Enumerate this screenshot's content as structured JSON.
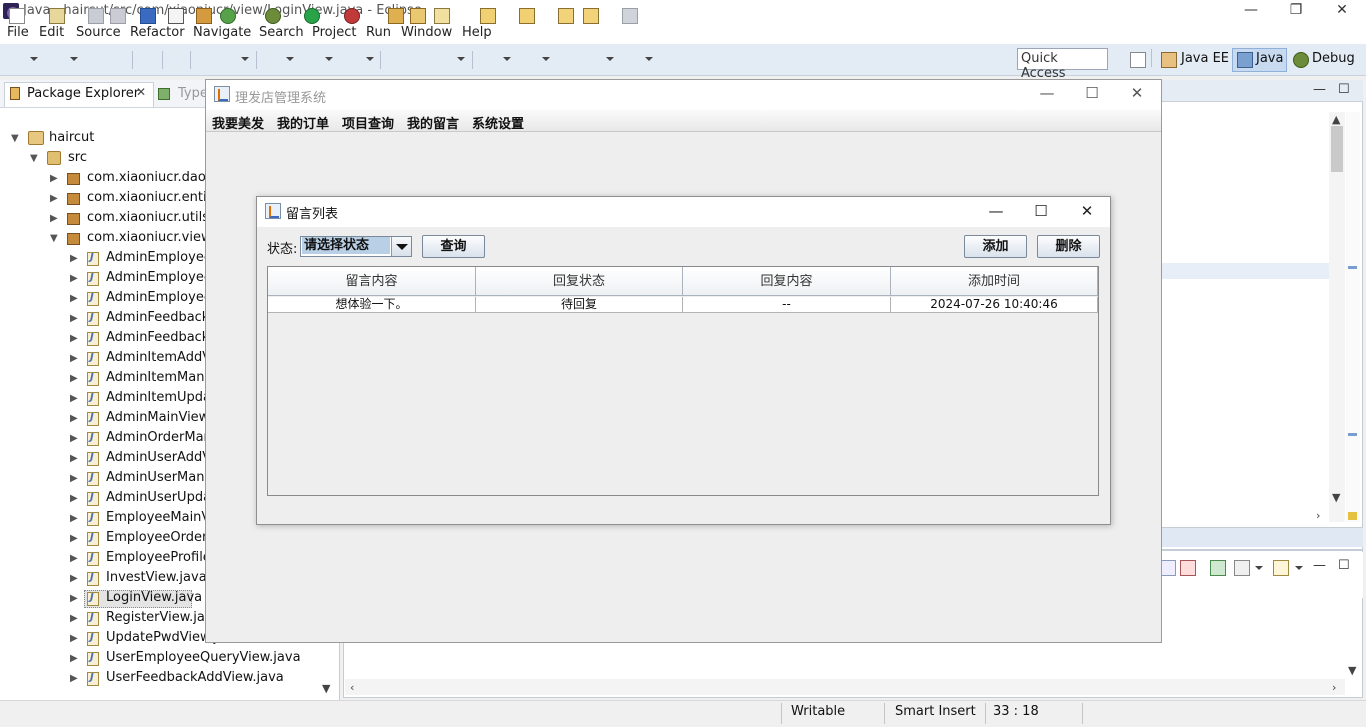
{
  "eclipse": {
    "title": "Java - haircut/src/com/xiaoniucr/view/LoginView.java - Eclipse",
    "menu": [
      "File",
      "Edit",
      "Source",
      "Refactor",
      "Navigate",
      "Search",
      "Project",
      "Run",
      "Window",
      "Help"
    ],
    "quick_access": "Quick Access",
    "perspectives": [
      "Java EE",
      "Java",
      "Debug"
    ]
  },
  "package_explorer": {
    "tab_label": "Package Explorer",
    "close_glyph": "✕",
    "second_tab": "Type",
    "project": "haircut",
    "src": "src",
    "packages": [
      "com.xiaoniucr.dao",
      "com.xiaoniucr.entity",
      "com.xiaoniucr.utils",
      "com.xiaoniucr.view"
    ],
    "files": [
      "AdminEmployeeA",
      "AdminEmployeeM",
      "AdminEmployeeU",
      "AdminFeedbackM",
      "AdminFeedbackR",
      "AdminItemAddVi",
      "AdminItemManag",
      "AdminItemUpdat",
      "AdminMainView.j",
      "AdminOrderMana",
      "AdminUserAddVi",
      "AdminUserManag",
      "AdminUserUpdat",
      "EmployeeMainVie",
      "EmployeeOrderM",
      "EmployeeProfileV",
      "InvestView.java",
      "LoginView.java",
      "RegisterView.java",
      "UpdatePwdView.java",
      "UserEmployeeQueryView.java",
      "UserFeedbackAddView.java"
    ]
  },
  "status_bar": {
    "writable": "Writable",
    "insert_mode": "Smart Insert",
    "position": "33 : 18"
  },
  "main_frame": {
    "title": "理发店管理系统",
    "menus": [
      "我要美发",
      "我的订单",
      "项目查询",
      "我的留言",
      "系统设置"
    ]
  },
  "dialog": {
    "title": "留言列表",
    "status_label": "状态:",
    "status_select": "请选择状态",
    "query_button": "查询",
    "add_button": "添加",
    "delete_button": "删除",
    "table": {
      "columns": [
        "留言内容",
        "回复状态",
        "回复内容",
        "添加时间"
      ],
      "rows": [
        [
          "想体验一下。",
          "待回复",
          "--",
          "2024-07-26 10:40:46"
        ]
      ]
    }
  },
  "window_controls": {
    "minimize": "—",
    "maximize": "☐",
    "close": "✕",
    "restore": "❐"
  }
}
